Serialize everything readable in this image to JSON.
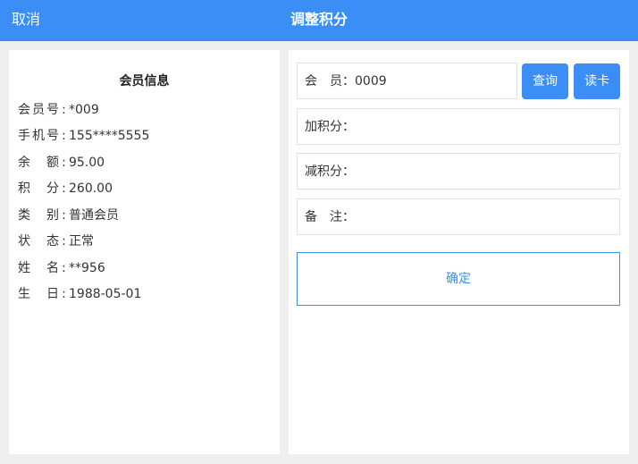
{
  "header": {
    "cancel_label": "取消",
    "title": "调整积分"
  },
  "member_info": {
    "title": "会员信息",
    "rows": [
      {
        "label": "会员号",
        "value": "*009"
      },
      {
        "label": "手机号",
        "value": "155****5555"
      },
      {
        "label": "余额",
        "value": "95.00"
      },
      {
        "label": "积分",
        "value": "260.00"
      },
      {
        "label": "类别",
        "value": "普通会员"
      },
      {
        "label": "状态",
        "value": "正常"
      },
      {
        "label": "姓名",
        "value": "**956"
      },
      {
        "label": "生日",
        "value": "1988-05-01"
      }
    ]
  },
  "form": {
    "member_label": "会　员：",
    "member_value": "0009",
    "query_button": "查询",
    "read_card_button": "读卡",
    "add_points_label": "加积分：",
    "add_points_value": "",
    "reduce_points_label": "减积分：",
    "reduce_points_value": "",
    "remark_label": "备　注：",
    "remark_value": "",
    "confirm_button": "确定"
  },
  "colors": {
    "accent": "#3a8ef6",
    "background": "#efefef"
  }
}
